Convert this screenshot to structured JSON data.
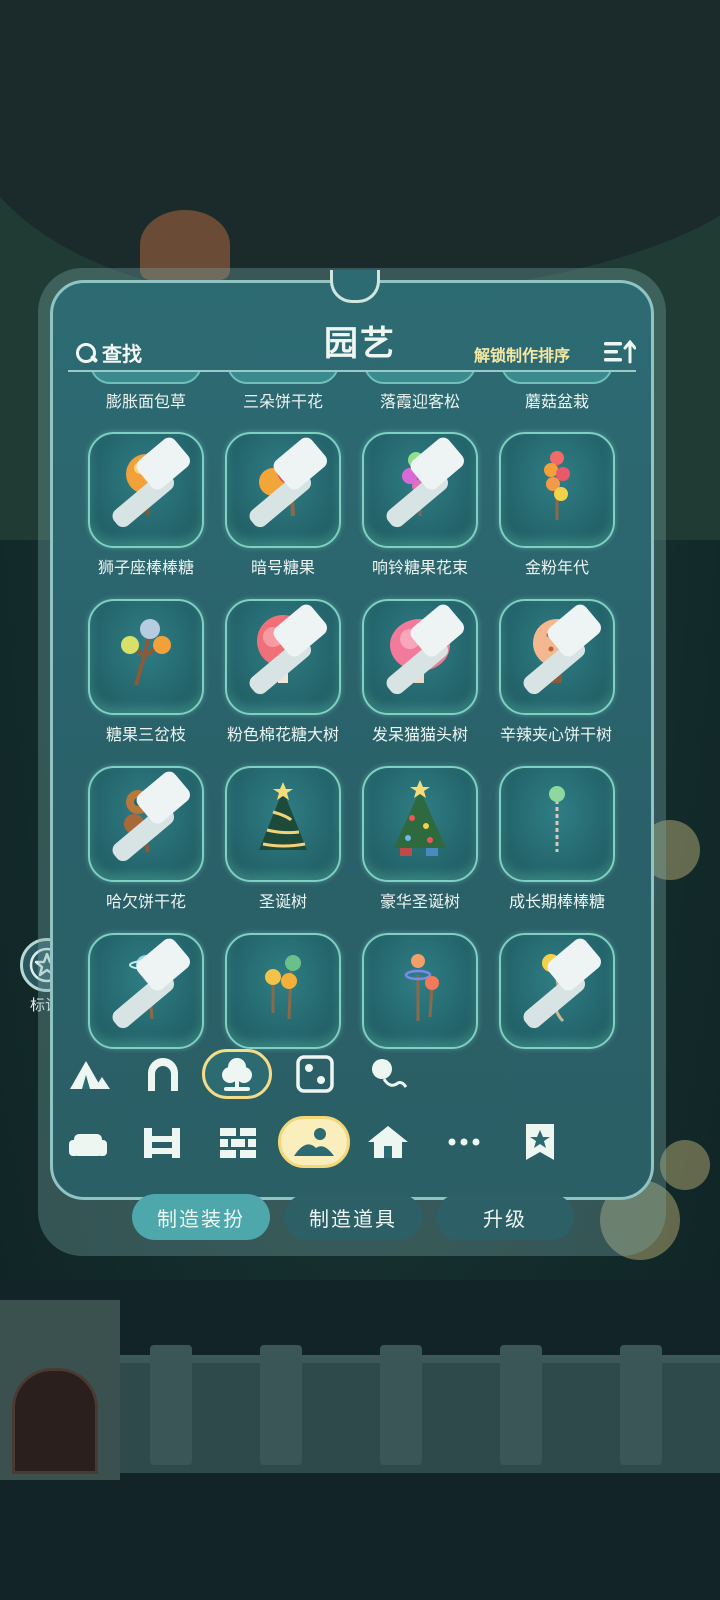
{
  "header": {
    "title": "园艺",
    "search_label": "查找",
    "sort_label": "解锁制作排序"
  },
  "partial_row": [
    "膨胀面包草",
    "三朵饼干花",
    "落霞迎客松",
    "蘑菇盆栽"
  ],
  "items": [
    {
      "label": "狮子座棒棒糖",
      "icon": "lollipop-orange-icon"
    },
    {
      "label": "暗号糖果",
      "icon": "candy-pair-icon"
    },
    {
      "label": "响铃糖果花束",
      "icon": "candy-bouquet-icon"
    },
    {
      "label": "金粉年代",
      "icon": "candy-stack-icon"
    },
    {
      "label": "糖果三岔枝",
      "icon": "candy-branch-icon"
    },
    {
      "label": "粉色棉花糖大树",
      "icon": "pink-cotton-tree-icon"
    },
    {
      "label": "发呆猫猫头树",
      "icon": "cat-head-tree-icon"
    },
    {
      "label": "辛辣夹心饼干树",
      "icon": "cookie-tree-icon"
    },
    {
      "label": "哈欠饼干花",
      "icon": "cookie-flower-icon"
    },
    {
      "label": "圣诞树",
      "icon": "christmas-tree-icon"
    },
    {
      "label": "豪华圣诞树",
      "icon": "deluxe-christmas-tree-icon"
    },
    {
      "label": "成长期棒棒糖",
      "icon": "growing-lollipop-icon"
    },
    {
      "label": "",
      "icon": "planet-lollipop-icon"
    },
    {
      "label": "",
      "icon": "triple-lollipop-icon"
    },
    {
      "label": "",
      "icon": "ringed-candy-icon"
    },
    {
      "label": "",
      "icon": "yellow-candy-vine-icon"
    }
  ],
  "sub_tabs": [
    "tent-icon",
    "arch-icon",
    "tree-icon",
    "dice-icon",
    "balloon-icon"
  ],
  "categories": [
    "sofa-icon",
    "fence-icon",
    "brick-wall-icon",
    "landscape-icon",
    "house-icon",
    "more-icon",
    "badge-icon"
  ],
  "bottom_buttons": {
    "craft_decor": "制造装扮",
    "craft_tool": "制造道具",
    "upgrade": "升级"
  },
  "side": {
    "mark_label": "标记"
  },
  "colors": {
    "accent_gold": "#f4d877",
    "panel_teal": "#2d6b73",
    "active_button": "#4da7ab"
  }
}
